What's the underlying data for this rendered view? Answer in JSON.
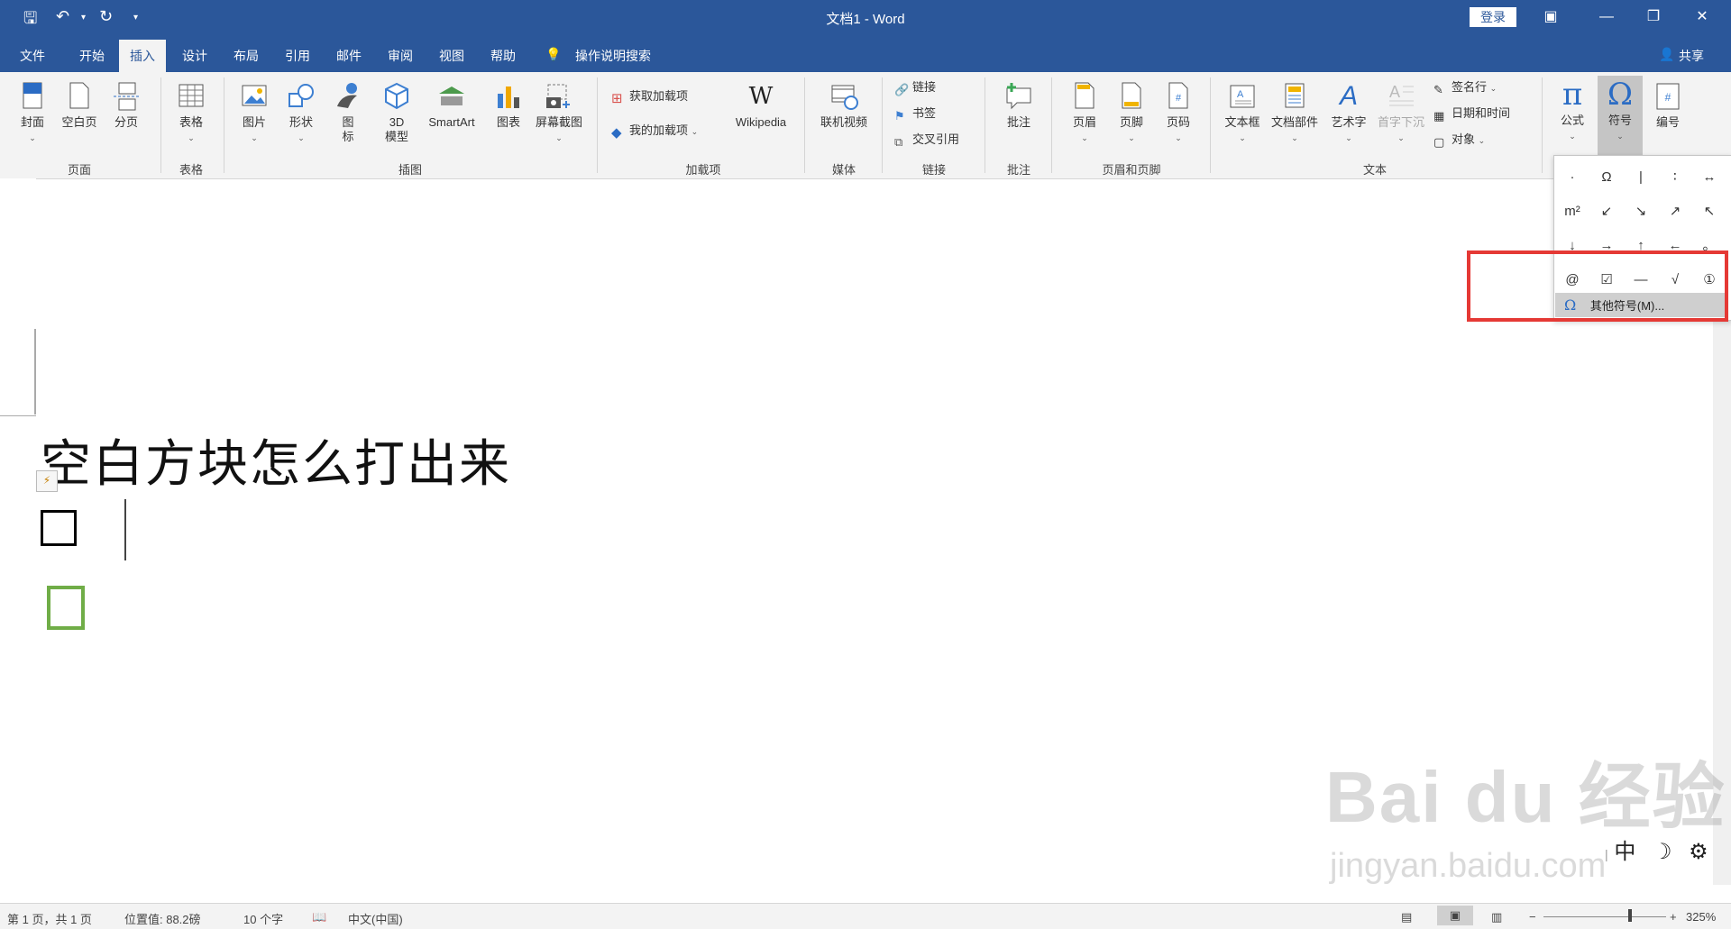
{
  "titlebar": {
    "title": "文档1 - Word",
    "login": "登录",
    "quick_access": [
      "save-icon",
      "undo-icon",
      "redo-icon",
      "customize-icon"
    ]
  },
  "tabs": {
    "file": "文件",
    "home": "开始",
    "insert": "插入",
    "design": "设计",
    "layout": "布局",
    "references": "引用",
    "mailings": "邮件",
    "review": "审阅",
    "view": "视图",
    "help": "帮助",
    "tellme": "操作说明搜索",
    "share": "共享"
  },
  "ribbon": {
    "pages": {
      "cover": "封面",
      "blank": "空白页",
      "break": "分页",
      "group": "页面"
    },
    "tables": {
      "table": "表格",
      "group": "表格"
    },
    "illustrations": {
      "pictures": "图片",
      "shapes": "形状",
      "icons_1": "图",
      "icons_2": "标",
      "model_1": "3D",
      "model_2": "模型",
      "smartart": "SmartArt",
      "chart": "图表",
      "screenshot": "屏幕截图",
      "group": "插图"
    },
    "addins": {
      "get": "获取加载项",
      "mine": "我的加载项",
      "wiki": "Wikipedia",
      "group": "加载项"
    },
    "media": {
      "video": "联机视频",
      "group": "媒体"
    },
    "links": {
      "link": "链接",
      "bookmark": "书签",
      "xref": "交叉引用",
      "group": "链接"
    },
    "comments": {
      "comment": "批注",
      "group": "批注"
    },
    "headerfooter": {
      "header": "页眉",
      "footer": "页脚",
      "pagenum": "页码",
      "group": "页眉和页脚"
    },
    "text": {
      "textbox": "文本框",
      "parts": "文档部件",
      "wordart": "艺术字",
      "dropcap": "首字下沉",
      "signature": "签名行",
      "datetime": "日期和时间",
      "object": "对象",
      "group": "文本"
    },
    "symbols": {
      "equation": "公式",
      "symbol": "符号",
      "number": "编号"
    }
  },
  "document": {
    "heading": "空白方块怎么打出来",
    "box1": "□",
    "box2": "□"
  },
  "symbol_dropdown": {
    "rows": [
      [
        "·",
        "Ω",
        "|",
        "∶",
        "↔"
      ],
      [
        "m²",
        "↙",
        "↘",
        "↗",
        "↖"
      ],
      [
        "↓",
        "→",
        "↑",
        "←",
        "。"
      ],
      [
        "@",
        "☑",
        "—",
        "√",
        "①"
      ]
    ],
    "more": "其他符号(M)..."
  },
  "statusbar": {
    "page": "第 1 页，共 1 页",
    "position": "位置值: 88.2磅",
    "words": "10 个字",
    "language": "中文(中国)",
    "zoom": "325%"
  },
  "ime": {
    "lang": "中",
    "moon": "☽",
    "gear": "⚙"
  },
  "watermark": {
    "brand": "Bai du 经验",
    "url": "jingyan.baidu.com"
  }
}
